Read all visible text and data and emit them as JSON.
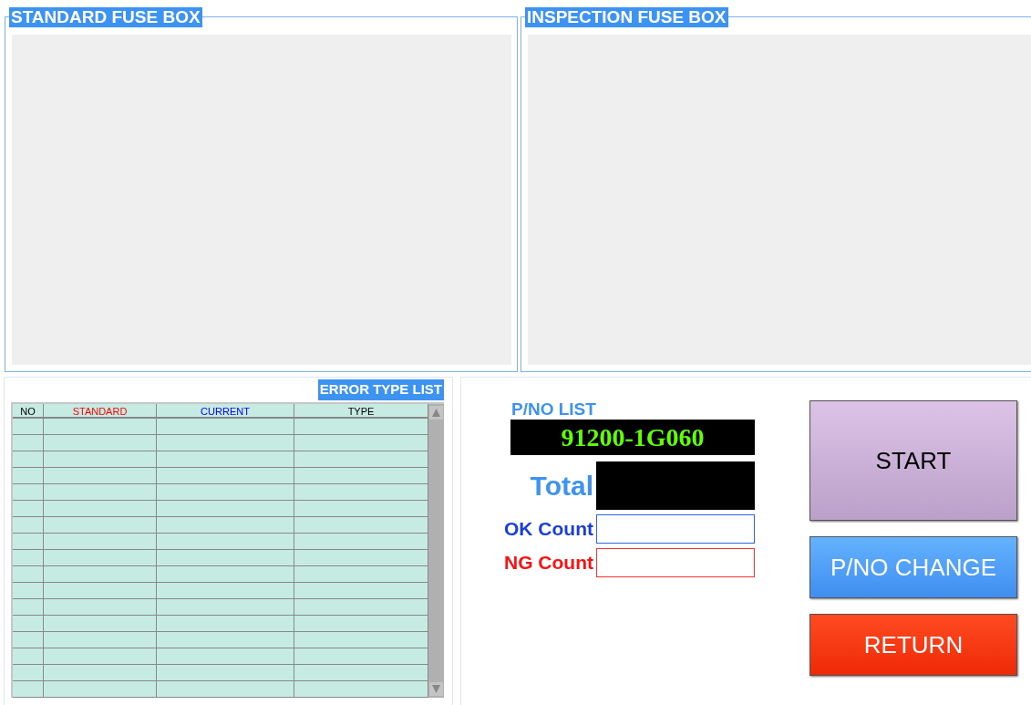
{
  "fuse_boxes": [
    {
      "title": "STANDARD FUSE BOX"
    },
    {
      "title": "INSPECTION FUSE BOX"
    }
  ],
  "error_list": {
    "title": "ERROR TYPE LIST",
    "columns": [
      {
        "label": "NO",
        "color": "#000000"
      },
      {
        "label": "STANDARD",
        "color": "#ff0000"
      },
      {
        "label": "CURRENT",
        "color": "#0000ff"
      },
      {
        "label": "TYPE",
        "color": "#000000"
      }
    ]
  },
  "pno": {
    "label": "P/NO LIST",
    "value": "91200-1G060"
  },
  "counters": [
    {
      "kind": "total",
      "label": "Total"
    },
    {
      "kind": "ok",
      "label": "OK Count"
    },
    {
      "kind": "ng",
      "label": "NG Count"
    }
  ],
  "buttons": [
    {
      "kind": "start",
      "label": "START"
    },
    {
      "kind": "change",
      "label": "P/NO CHANGE"
    },
    {
      "kind": "return",
      "label": "RETURN"
    }
  ]
}
